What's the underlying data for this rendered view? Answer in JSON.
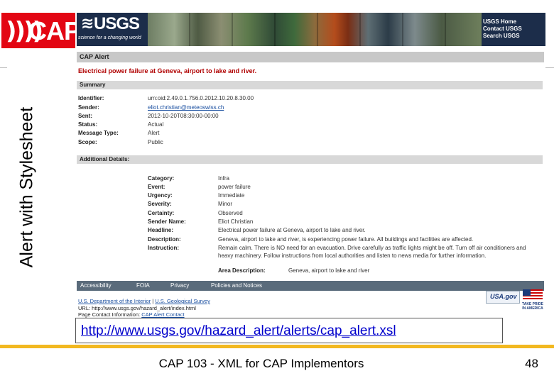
{
  "slide": {
    "vertical_title": "Alert with Stylesheet",
    "url": "http://www.usgs.gov/hazard_alert/alerts/cap_alert.xsl",
    "footer": "CAP 103 - XML for CAP Implementors",
    "page_number": "48"
  },
  "logos": {
    "cap_text": "CAP",
    "usgs_text": "USGS",
    "usgs_tagline": "science for a changing world"
  },
  "header_links": [
    "USGS Home",
    "Contact USGS",
    "Search USGS"
  ],
  "alert": {
    "panel_title": "CAP Alert",
    "headline": "Electrical power failure at Geneva, airport to lake and river.",
    "summary_title": "Summary",
    "summary": [
      {
        "label": "Identifier:",
        "value": "urn:oid:2.49.0.1.756.0.2012.10.20.8.30.00"
      },
      {
        "label": "Sender:",
        "value": "eliot.christian@meteoswiss.ch"
      },
      {
        "label": "Sent:",
        "value": "2012-10-20T08:30:00-00:00"
      },
      {
        "label": "Status:",
        "value": "Actual"
      },
      {
        "label": "Message Type:",
        "value": "Alert"
      },
      {
        "label": "Scope:",
        "value": "Public"
      }
    ],
    "details_title": "Additional Details:",
    "details": [
      {
        "label": "Category:",
        "value": "Infra"
      },
      {
        "label": "Event:",
        "value": "power failure"
      },
      {
        "label": "Urgency:",
        "value": "Immediate"
      },
      {
        "label": "Severity:",
        "value": "Minor"
      },
      {
        "label": "Certainty:",
        "value": "Observed"
      },
      {
        "label": "Sender Name:",
        "value": "Eliot Christian"
      },
      {
        "label": "Headline:",
        "value": "Electrical power failure at Geneva, airport to lake and river."
      },
      {
        "label": "Description:",
        "value": "Geneva, airport to lake and river, is experiencing power failure. All buildings and facilities are affected."
      },
      {
        "label": "Instruction:",
        "value": "Remain calm. There is NO need for an evacuation. Drive carefully as traffic lights might be off. Turn off air conditioners and heavy machinery. Follow instructions from local authorities and listen to news media for further information."
      }
    ],
    "area_label": "Area Description:",
    "area_value": "Geneva, airport to lake and river"
  },
  "footer_nav": [
    "Accessibility",
    "FOIA",
    "Privacy",
    "Policies and Notices"
  ],
  "footer_info": {
    "doi": "U.S. Department of the Interior",
    "sep": "|",
    "gs": "U.S. Geological Survey",
    "url_line": "URL: http://www.usgs.gov/hazard_alert/index.html",
    "contact_label": "Page Contact Information:",
    "contact_link": "CAP Alert Contact"
  },
  "badges": {
    "usagov": "USA.gov",
    "pride": "TAKE PRIDE IN AMERICA"
  }
}
